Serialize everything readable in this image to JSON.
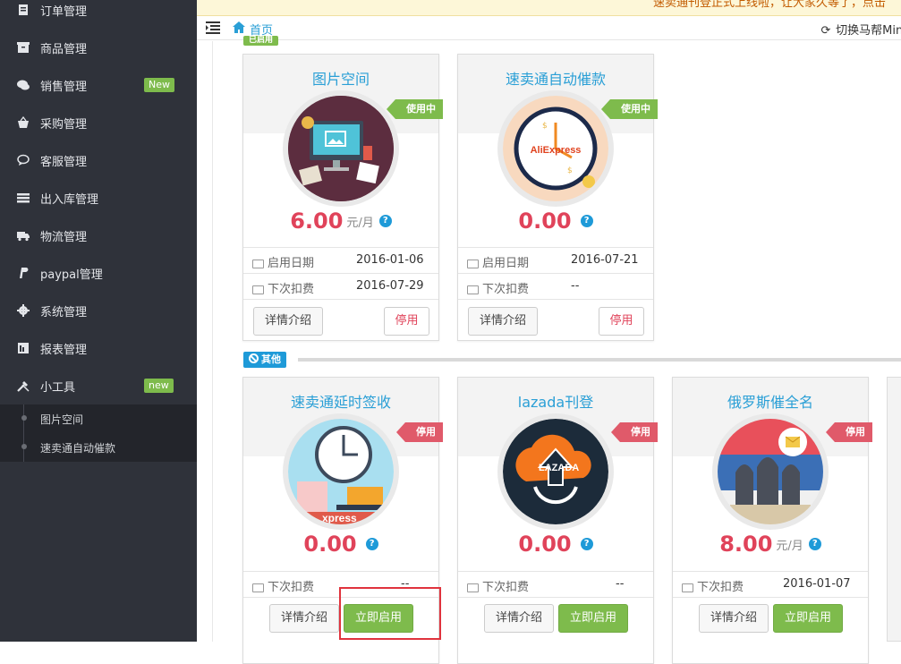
{
  "sidebar": {
    "items": [
      {
        "label": "订单管理",
        "icon": "clipboard-icon"
      },
      {
        "label": "商品管理",
        "icon": "box-icon"
      },
      {
        "label": "销售管理",
        "icon": "chat-icon",
        "badge": "New"
      },
      {
        "label": "采购管理",
        "icon": "basket-icon"
      },
      {
        "label": "客服管理",
        "icon": "speech-icon"
      },
      {
        "label": "出入库管理",
        "icon": "list-icon"
      },
      {
        "label": "物流管理",
        "icon": "truck-icon"
      },
      {
        "label": "paypal管理",
        "icon": "paypal-icon"
      },
      {
        "label": "系统管理",
        "icon": "gear-icon"
      },
      {
        "label": "报表管理",
        "icon": "report-icon"
      },
      {
        "label": "小工具",
        "icon": "tools-icon",
        "badge": "new"
      }
    ],
    "subitems": [
      {
        "label": "图片空间"
      },
      {
        "label": "速卖通自动催款"
      }
    ]
  },
  "notice": {
    "text": "速卖通刊登正式上线啦，让大家久等了，点击"
  },
  "topbar": {
    "home_label": "首页",
    "switch_label": "切换马帮Mini"
  },
  "sections": {
    "inuse_tag": "已启用",
    "other_tag": "其他"
  },
  "cards": [
    {
      "title": "图片空间",
      "status": "使用中",
      "price": "6.00",
      "unit": "元/月",
      "start_label": "启用日期",
      "start_value": "2016-01-06",
      "next_label": "下次扣费",
      "next_value": "2016-07-29",
      "detail_btn": "详情介绍",
      "action_btn": "停用"
    },
    {
      "title": "速卖通自动催款",
      "status": "使用中",
      "price": "0.00",
      "unit": "",
      "start_label": "启用日期",
      "start_value": "2016-07-21",
      "next_label": "下次扣费",
      "next_value": "--",
      "detail_btn": "详情介绍",
      "action_btn": "停用"
    },
    {
      "title": "速卖通延时签收",
      "status": "停用",
      "price": "0.00",
      "unit": "",
      "next_label": "下次扣费",
      "next_value": "--",
      "detail_btn": "详情介绍",
      "action_btn": "立即启用"
    },
    {
      "title": "lazada刊登",
      "status": "停用",
      "price": "0.00",
      "unit": "",
      "next_label": "下次扣费",
      "next_value": "--",
      "detail_btn": "详情介绍",
      "action_btn": "立即启用"
    },
    {
      "title": "俄罗斯催全名",
      "status": "停用",
      "price": "8.00",
      "unit": "元/月",
      "next_label": "下次扣费",
      "next_value": "2016-01-07",
      "detail_btn": "详情介绍",
      "action_btn": "立即启用"
    }
  ],
  "logos": {
    "aliexpress": "AliExpress",
    "lazada": "LAZADA",
    "express_fragment": "xpress"
  },
  "colors": {
    "sidebar_bg": "#2f323a",
    "accent_blue": "#2a9fd6",
    "price_red": "#e0435a",
    "badge_green": "#7ebb4c",
    "ribbon_red": "#e05a6a"
  }
}
